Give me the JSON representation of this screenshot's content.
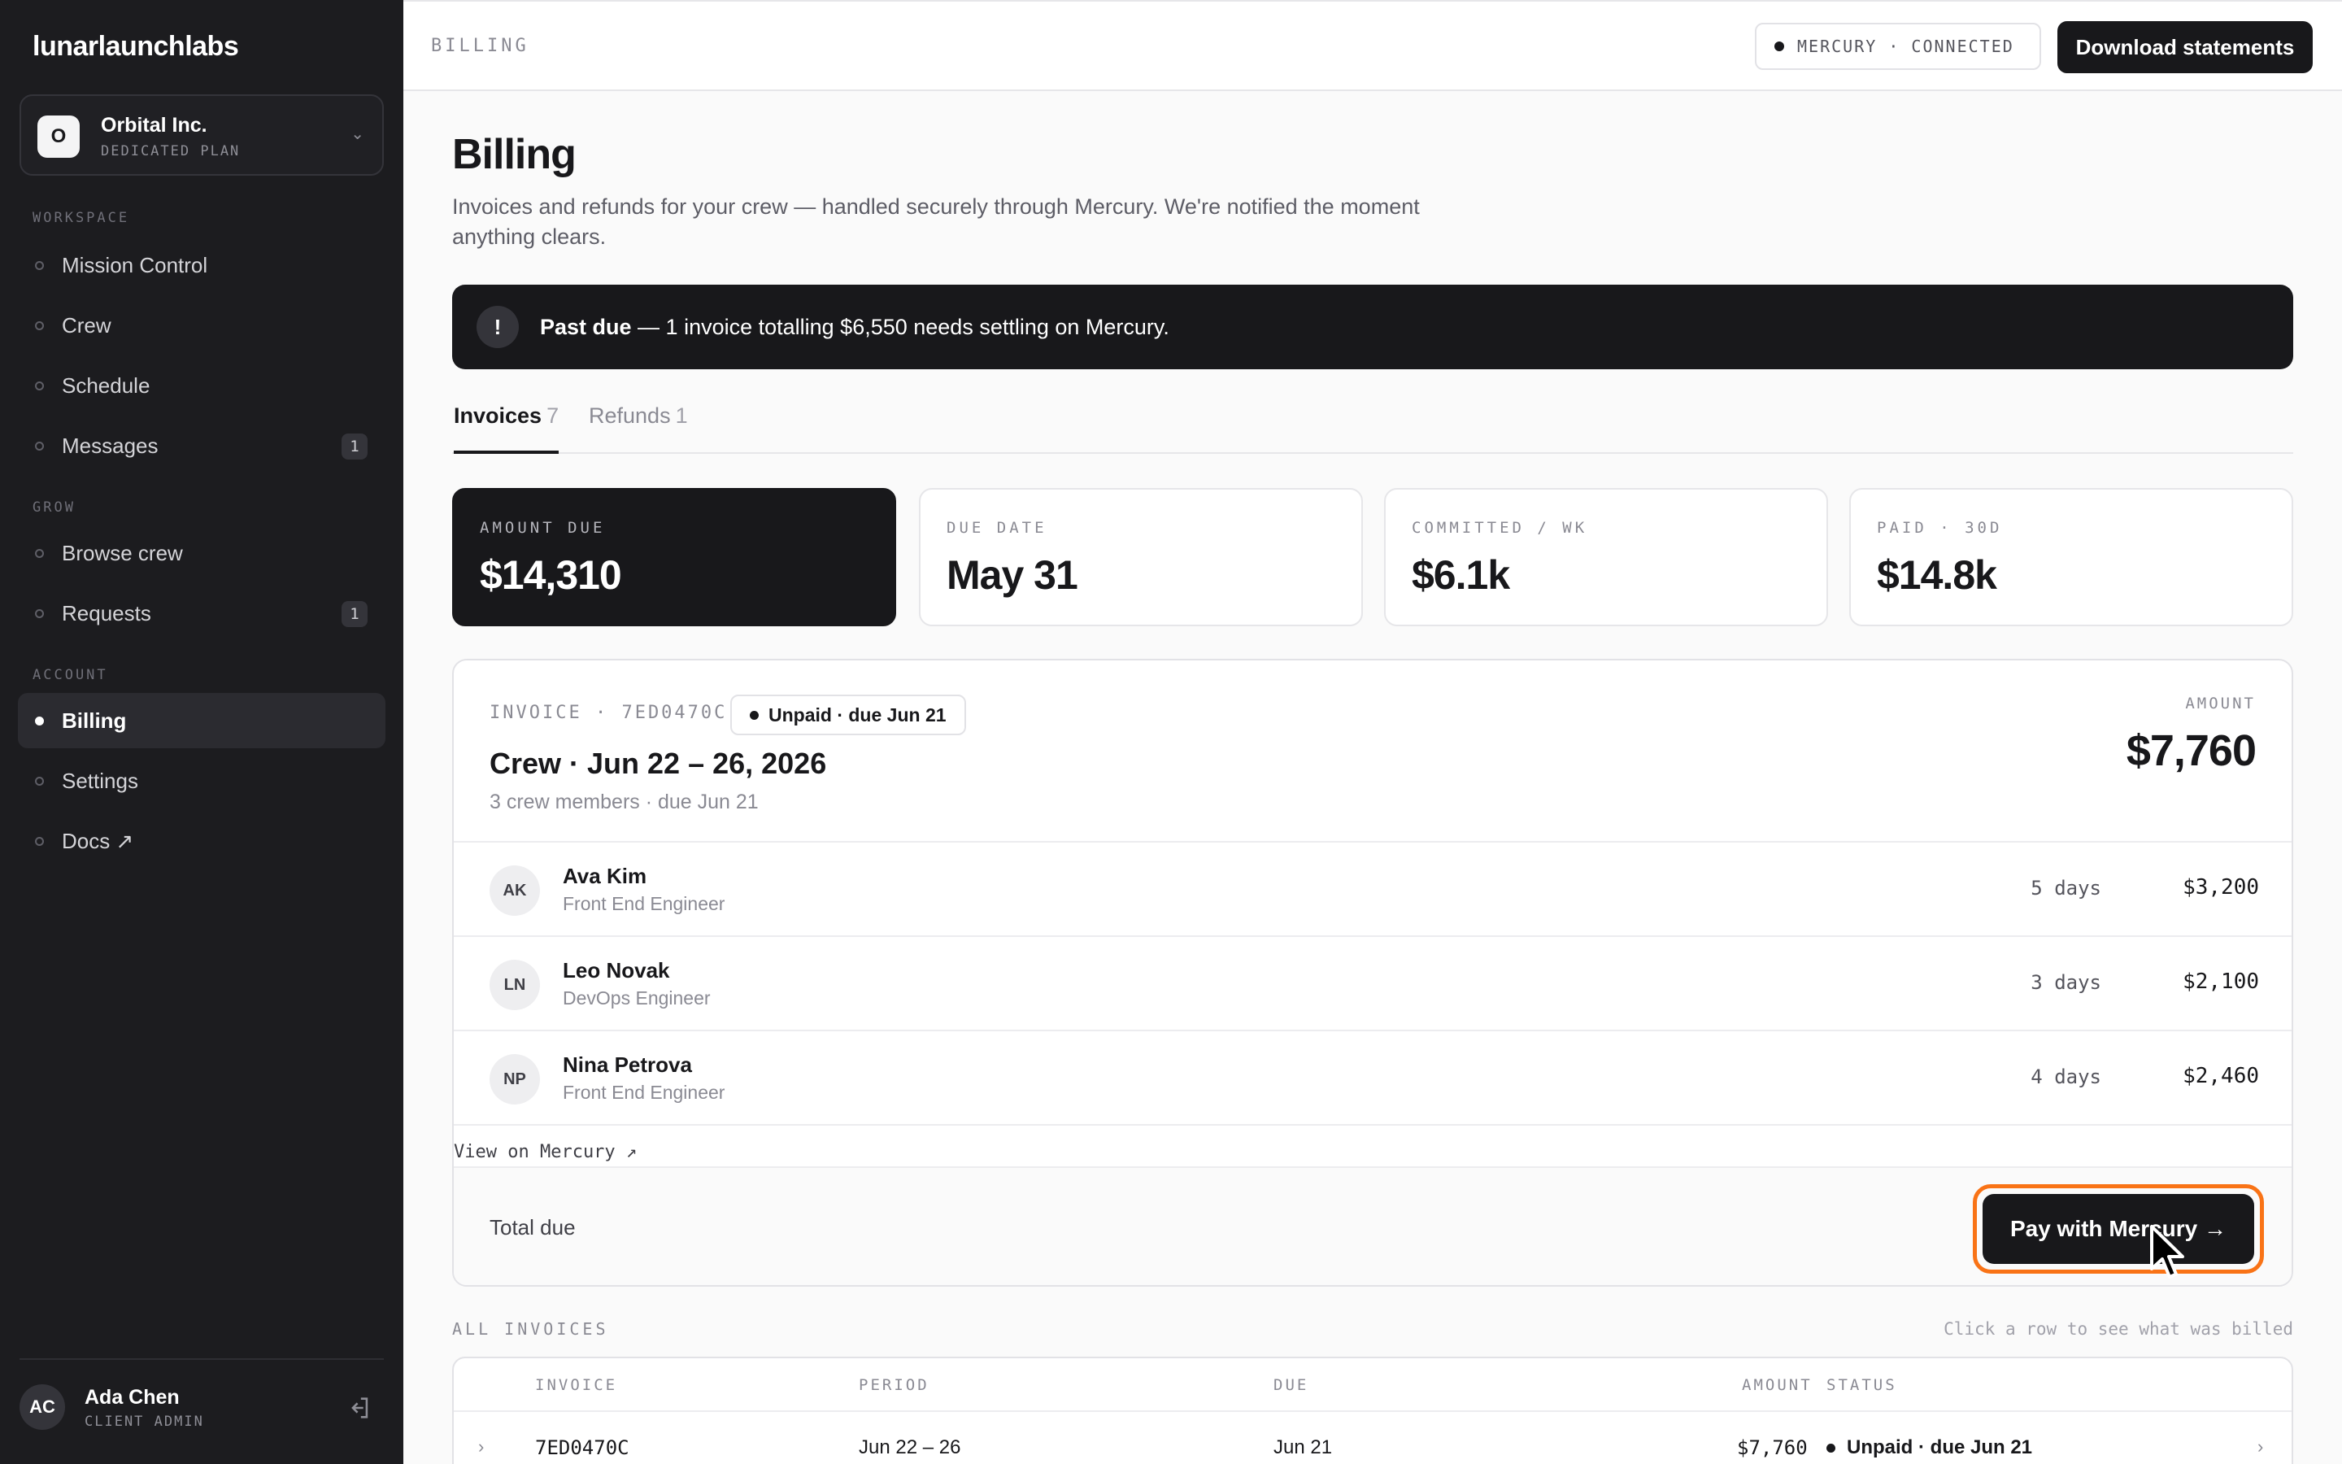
{
  "brand": "lunarlaunchlabs",
  "org": {
    "initial": "O",
    "name": "Orbital Inc.",
    "plan": "DEDICATED PLAN"
  },
  "nav": {
    "workspace_label": "WORKSPACE",
    "grow_label": "GROW",
    "account_label": "ACCOUNT",
    "items": [
      {
        "label": "Mission Control"
      },
      {
        "label": "Crew"
      },
      {
        "label": "Schedule"
      },
      {
        "label": "Messages",
        "badge": "1"
      },
      {
        "label": "Browse crew"
      },
      {
        "label": "Requests",
        "badge": "1"
      },
      {
        "label": "Billing",
        "active": true
      },
      {
        "label": "Settings"
      },
      {
        "label": "Docs ↗"
      }
    ]
  },
  "user": {
    "initials": "AC",
    "name": "Ada Chen",
    "role": "CLIENT ADMIN"
  },
  "topbar": {
    "title": "BILLING",
    "connection": "MERCURY · CONNECTED",
    "download_label": "Download statements"
  },
  "header": {
    "title": "Billing",
    "subtitle": "Invoices and refunds for your crew — handled securely through Mercury. We're notified the moment anything clears."
  },
  "alert": {
    "icon": "!",
    "strong": "Past due",
    "text": " — 1 invoice totalling $6,550 needs settling on Mercury."
  },
  "tabs": [
    {
      "label": "Invoices",
      "count": "7",
      "active": true
    },
    {
      "label": "Refunds",
      "count": "1"
    }
  ],
  "stats": [
    {
      "label": "AMOUNT DUE",
      "value": "$14,310"
    },
    {
      "label": "DUE DATE",
      "value": "May 31"
    },
    {
      "label": "COMMITTED / WK",
      "value": "$6.1k"
    },
    {
      "label": "PAID · 30D",
      "value": "$14.8k"
    }
  ],
  "invoice": {
    "label": "INVOICE · 7ED0470C",
    "status": "Unpaid · due Jun 21",
    "title": "Crew · Jun 22 – 26, 2026",
    "meta": "3 crew members · due Jun 21",
    "amount_label": "AMOUNT",
    "amount": "$7,760",
    "lines": [
      {
        "initials": "AK",
        "name": "Ava Kim",
        "role": "Front End Engineer",
        "days": "5 days",
        "amount": "$3,200"
      },
      {
        "initials": "LN",
        "name": "Leo Novak",
        "role": "DevOps Engineer",
        "days": "3 days",
        "amount": "$2,100"
      },
      {
        "initials": "NP",
        "name": "Nina Petrova",
        "role": "Front End Engineer",
        "days": "4 days",
        "amount": "$2,460"
      }
    ],
    "view_link": "View on Mercury ↗",
    "total_label": "Total due",
    "pay_label": "Pay with Mercury →"
  },
  "all_invoices": {
    "label": "ALL INVOICES",
    "hint": "Click a row to see what was billed",
    "columns": [
      "INVOICE",
      "PERIOD",
      "DUE",
      "AMOUNT",
      "STATUS"
    ],
    "rows": [
      {
        "invoice": "7ED0470C",
        "period": "Jun 22 – 26",
        "due": "Jun 21",
        "amount": "$7,760",
        "status": "Unpaid · due Jun 21"
      }
    ]
  }
}
